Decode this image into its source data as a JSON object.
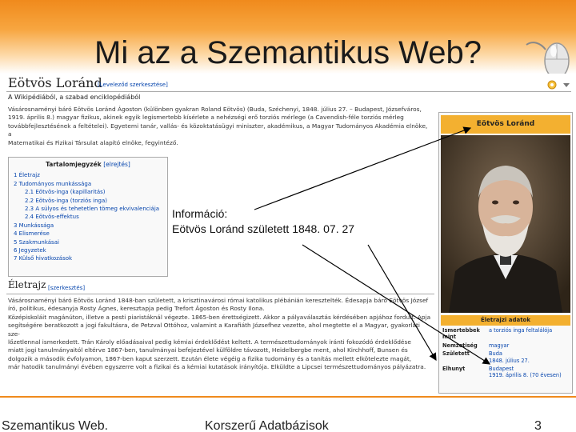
{
  "slide": {
    "title": "Mi az a Szemantikus Web?",
    "accent_color": "#f08a1c",
    "footer": {
      "left": "Szemantikus Web.",
      "center": "Korszerű Adatbázisok",
      "page": "3"
    },
    "callout": {
      "label": "Információ:",
      "text": "Eötvös Loránd született 1848. 07. 27"
    },
    "mouse_icon": "computer-mouse-icon"
  },
  "wiki": {
    "title": "Eötvös Loránd",
    "edit_link": "[Leveleződ szerkesztése]",
    "from_line": "A Wikipédiából, a szabad enciklopédiából",
    "intro_lines": [
      "Vásárosnaményi báró Eötvös Loránd Ágoston (különben gyakran Roland Eötvös) (Buda, Széchenyi, 1848. július 27. – Budapest, Józsefváros,",
      "1919. április 8.) magyar fizikus, akinek egyik legismertebb kísérlete a nehézségi erő torziós mérlege (a Cavendish-féle torziós mérleg",
      "továbbfejlesztésének a feltételei). Egyetemi tanár, vallás- és közoktatásügyi miniszter, akadémikus, a Magyar Tudományos Akadémia elnöke, a",
      "Matematikai és Fizikai Társulat alapító elnöke, fegyintéző."
    ],
    "toc": {
      "title": "Tartalomjegyzék",
      "edit": "[elrejtés]",
      "items": [
        {
          "label": "1 Életrajz",
          "sub": false
        },
        {
          "label": "2 Tudományos munkássága",
          "sub": false
        },
        {
          "label": "2.1 Eötvös-inga (kapillaritás)",
          "sub": true
        },
        {
          "label": "2.2 Eötvös-inga (torziós inga)",
          "sub": true
        },
        {
          "label": "2.3 A súlyos és tehetetlen tömeg ekvivalenciája",
          "sub": true
        },
        {
          "label": "2.4 Eötvös-effektus",
          "sub": true
        },
        {
          "label": "3 Munkássága",
          "sub": false
        },
        {
          "label": "4 Elismerése",
          "sub": false
        },
        {
          "label": "5 Szakmunkásai",
          "sub": false
        },
        {
          "label": "6 Jegyzetek",
          "sub": false
        },
        {
          "label": "7 Külső hivatkozások",
          "sub": false
        }
      ]
    },
    "section": {
      "title": "Életrajz",
      "edit": "[szerkesztés]",
      "lines": [
        "Vásárosnaményi báró Eötvös Loránd 1848-ban született, a krisztinavárosi római katolikus plébánián keresztelték. Édesapja báró Eötvös József",
        "író, politikus, édesanyja Rosty Ágnes, keresztapja pedig Trefort Ágoston és Rosty Ilona.",
        "Középiskoláit magánúton, illetve a pesti piaristáknál végezte. 1865-ben érettségizett. Akkor a pályaválasztás kérdésében apjához fordult. Apja",
        "segítségére beratkozott a jogi fakultásra, de Petzval Ottóhoz, valamint a Karafiáth Józsefhez vezette, ahol megtette el a Magyar, gyakorlati sze-",
        "lőzetlennal ismerkedett. Trán Károly előadásaival pedig kémiai érdeklődést keltett. A természettudományok iránti fokozódó érdeklődése",
        "miatt jogi tanulmányaitól eltérve 1867-ben, tanulmányai befejeztével külföldre távozott, Heidelbergbe ment, ahol Kirchhoff, Bunsen és",
        "dolgozik a második évfolyamon, 1867-ben kaput szerzett. Ezután élete végéig a fizika tudomány és a tanítás mellett elkötelezte magát,",
        "már hatodik tanulmányi évében egyszerre volt a fizikai és a kémiai kutatások irányítója. Elküldte a Lipcsei természettudományos pályázatra."
      ]
    },
    "infobox": {
      "name": "Eötvös Loránd",
      "details_title": "Életrajzi adatok",
      "rows": [
        {
          "key": "Ismertebbek mint",
          "value": "a torziós inga feltalálója"
        },
        {
          "key": "Nemzetiség",
          "value": "magyar"
        },
        {
          "key": "Született",
          "value": "Buda\n1848. július 27."
        },
        {
          "key": "Elhunyt",
          "value": "Budapest\n1919. április 8. (70 évesen)"
        }
      ]
    }
  }
}
